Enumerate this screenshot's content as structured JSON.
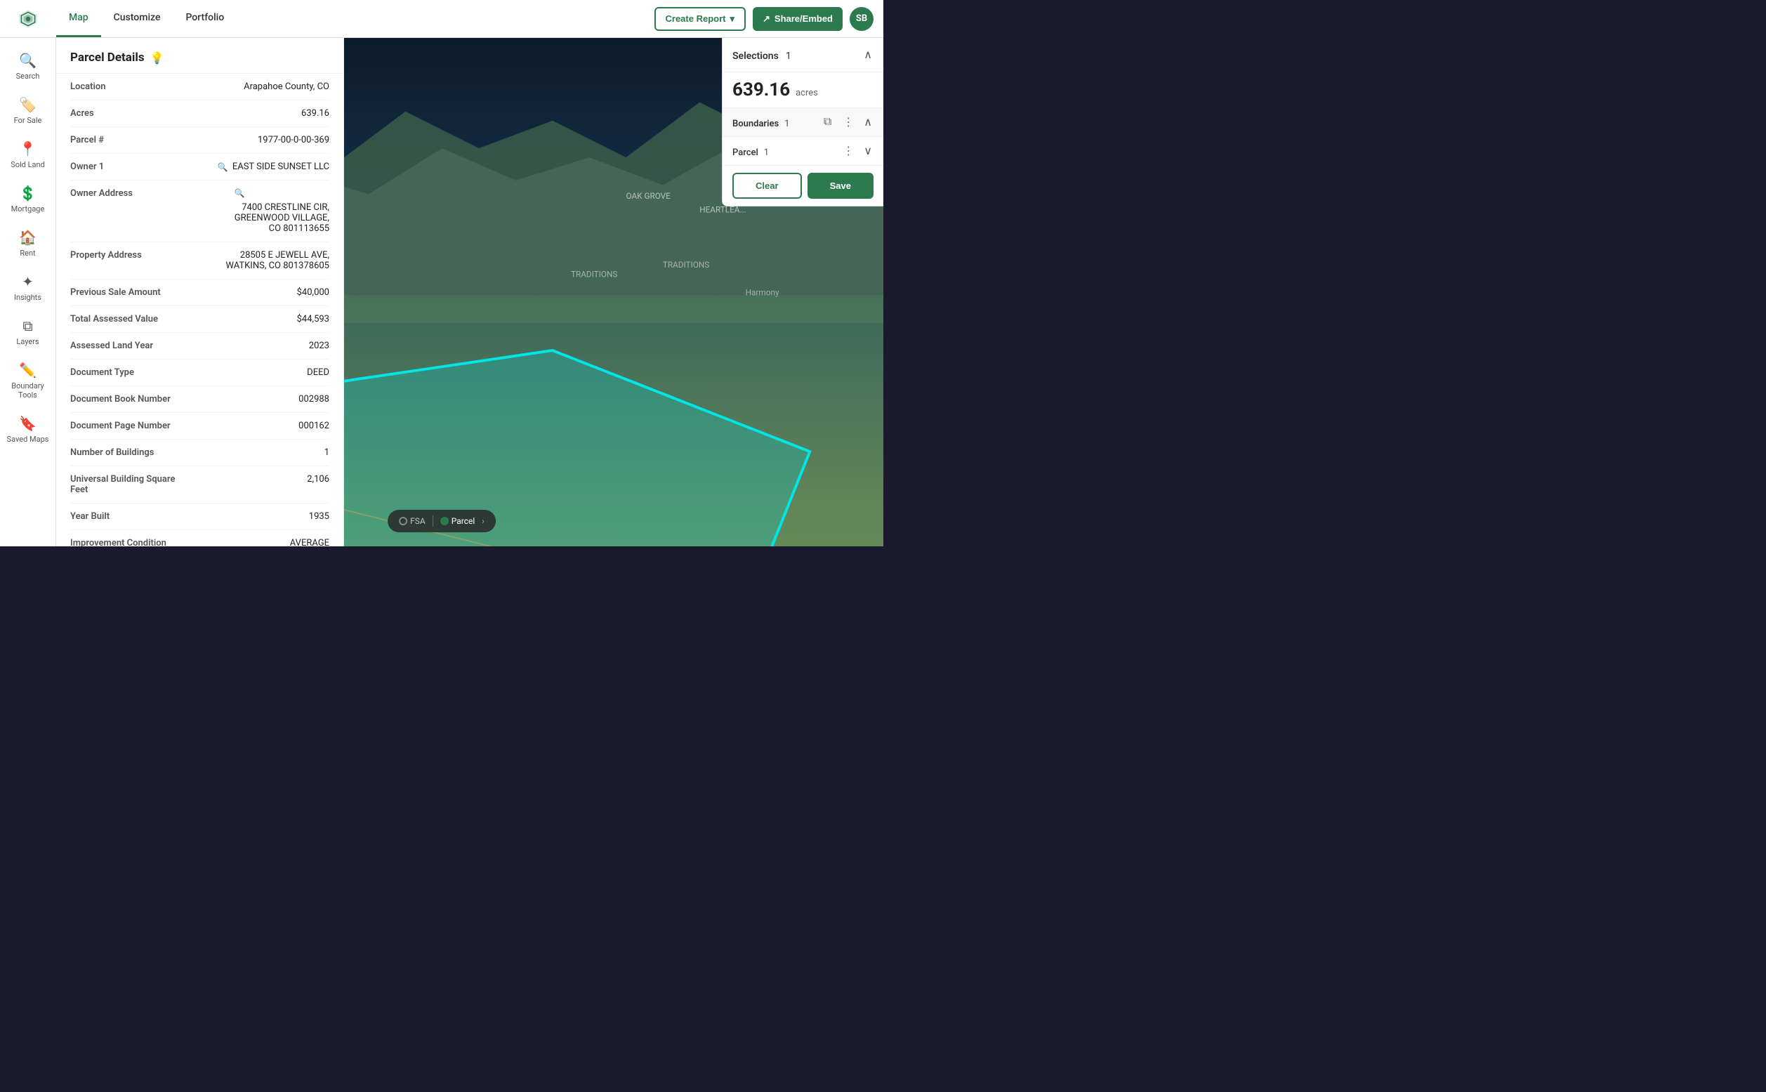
{
  "nav": {
    "tabs": [
      {
        "label": "Map",
        "active": true
      },
      {
        "label": "Customize",
        "active": false
      },
      {
        "label": "Portfolio",
        "active": false
      }
    ],
    "create_report": "Create Report",
    "share_embed": "Share/Embed",
    "avatar": "SB"
  },
  "sidebar": {
    "items": [
      {
        "label": "Search",
        "icon": "🔍"
      },
      {
        "label": "For Sale",
        "icon": "🏷️"
      },
      {
        "label": "Sold Land",
        "icon": "📍"
      },
      {
        "label": "Mortgage",
        "icon": "💲"
      },
      {
        "label": "Rent",
        "icon": "🏠"
      },
      {
        "label": "Insights",
        "icon": "✦"
      },
      {
        "label": "Layers",
        "icon": "⧉"
      },
      {
        "label": "Boundary Tools",
        "icon": "✏️"
      },
      {
        "label": "Saved Maps",
        "icon": "🔖"
      }
    ]
  },
  "parcel_panel": {
    "title": "Parcel Details",
    "fields": [
      {
        "label": "Location",
        "value": "Arapahoe County, CO",
        "has_search": false
      },
      {
        "label": "Acres",
        "value": "639.16",
        "has_search": false
      },
      {
        "label": "Parcel #",
        "value": "1977-00-0-00-369",
        "has_search": false
      },
      {
        "label": "Owner 1",
        "value": "EAST SIDE SUNSET LLC",
        "has_search": true
      },
      {
        "label": "Owner Address",
        "value": "7400 CRESTLINE CIR, GREENWOOD VILLAGE, CO 801113655",
        "has_search": true
      },
      {
        "label": "Property Address",
        "value": "28505 E JEWELL AVE, WATKINS, CO 801378605",
        "has_search": false
      },
      {
        "label": "Previous Sale Amount",
        "value": "$40,000",
        "has_search": false
      },
      {
        "label": "Total Assessed Value",
        "value": "$44,593",
        "has_search": false
      },
      {
        "label": "Assessed Land Year",
        "value": "2023",
        "has_search": false
      },
      {
        "label": "Document Type",
        "value": "DEED",
        "has_search": false
      },
      {
        "label": "Document Book Number",
        "value": "002988",
        "has_search": false
      },
      {
        "label": "Document Page Number",
        "value": "000162",
        "has_search": false
      },
      {
        "label": "Number of Buildings",
        "value": "1",
        "has_search": false
      },
      {
        "label": "Universal Building Square Feet",
        "value": "2,106",
        "has_search": false
      },
      {
        "label": "Year Built",
        "value": "1935",
        "has_search": false
      },
      {
        "label": "Improvement Condition",
        "value": "AVERAGE",
        "has_search": false
      }
    ]
  },
  "selections_panel": {
    "title": "Selections",
    "count": "1",
    "acres": "639.16",
    "acres_label": "acres",
    "boundaries_label": "Boundaries",
    "boundaries_count": "1",
    "parcel_label": "Parcel",
    "parcel_count": "1",
    "btn_clear": "Clear",
    "btn_save": "Save"
  },
  "bottom_bar": {
    "option1": "FSA",
    "option2": "Parcel",
    "option2_active": true
  }
}
